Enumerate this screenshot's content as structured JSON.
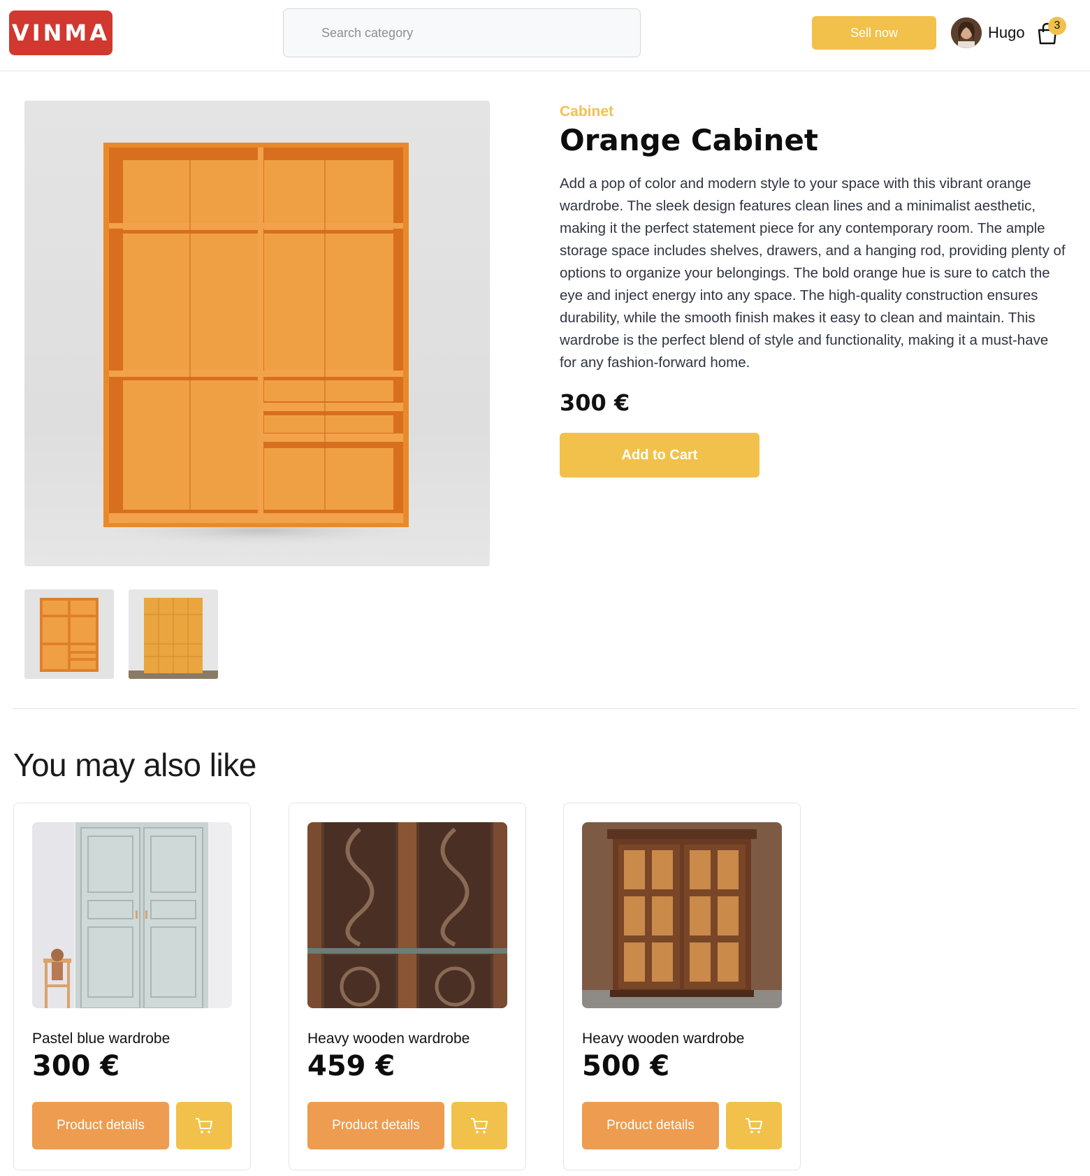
{
  "header": {
    "logo_text": "VINMA",
    "search_placeholder": "Search category",
    "sell_label": "Sell now",
    "username": "Hugo",
    "cart_count": "3"
  },
  "product": {
    "category": "Cabinet",
    "title": "Orange Cabinet",
    "description": "Add a pop of color and modern style to your space with this vibrant orange wardrobe. The sleek design features clean lines and a minimalist aesthetic, making it the perfect statement piece for any contemporary room. The ample storage space includes shelves, drawers, and a hanging rod, providing plenty of options to organize your belongings. The bold orange hue is sure to catch the eye and inject energy into any space. The high-quality construction ensures durability, while the smooth finish makes it easy to clean and maintain. This wardrobe is the perfect blend of style and functionality, making it a must-have for any fashion-forward home.",
    "price": "300 €",
    "add_to_cart_label": "Add to Cart"
  },
  "recommendations": {
    "heading": "You may also like",
    "items": [
      {
        "name": "Pastel blue wardrobe",
        "price": "300 €",
        "details_label": "Product details"
      },
      {
        "name": "Heavy wooden wardrobe",
        "price": "459 €",
        "details_label": "Product details"
      },
      {
        "name": "Heavy wooden wardrobe",
        "price": "500 €",
        "details_label": "Product details"
      }
    ]
  },
  "colors": {
    "brand_red": "#d1382f",
    "accent_yellow": "#f2c14b",
    "details_orange": "#ee9c4f"
  },
  "icons": {
    "cart": "shopping-bag-icon",
    "cart_button": "shopping-cart-icon"
  }
}
